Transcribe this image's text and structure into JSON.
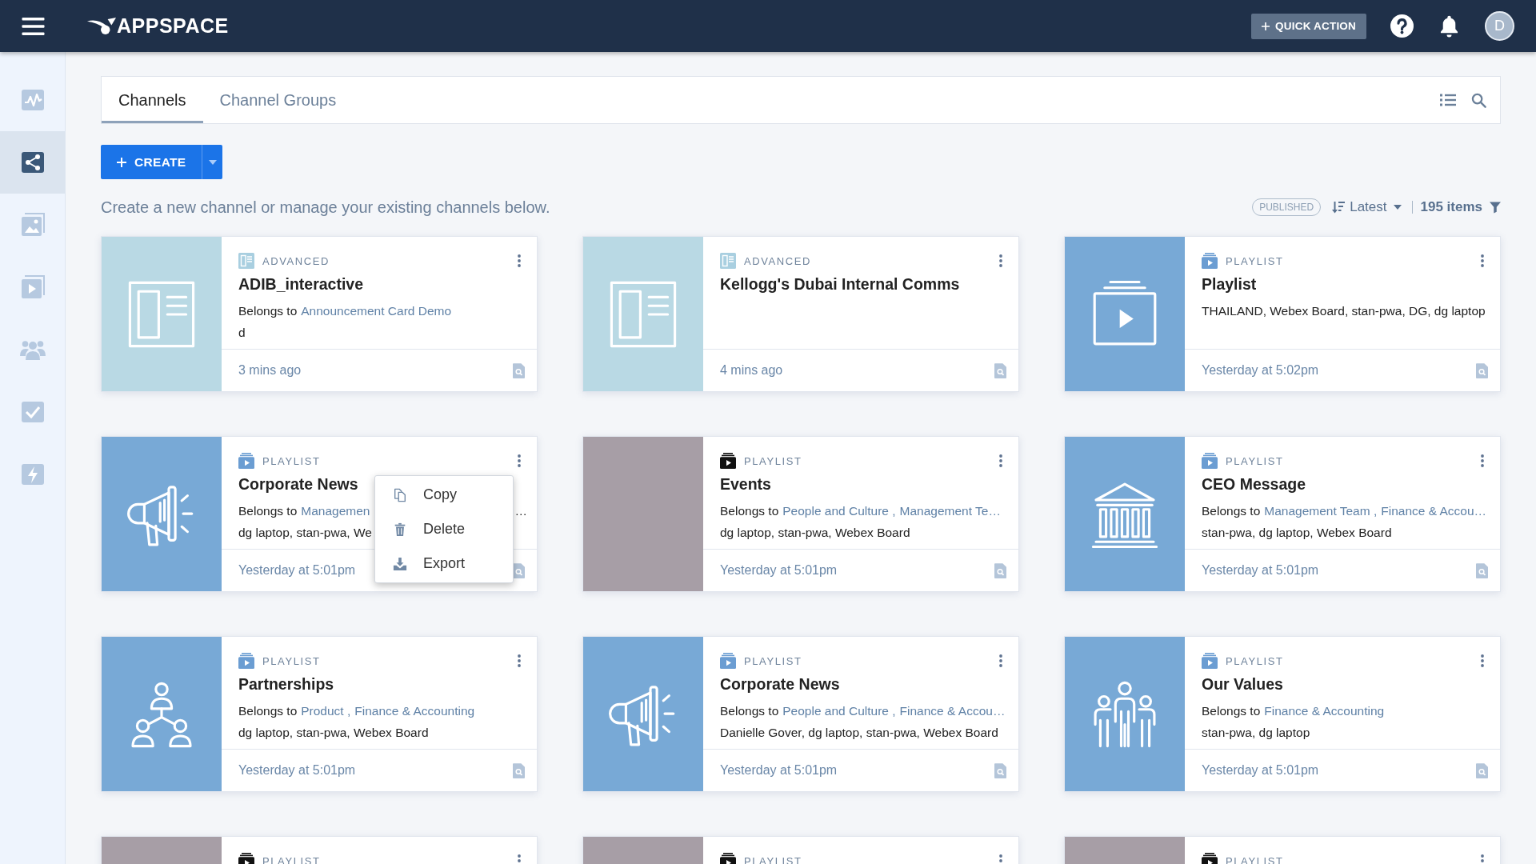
{
  "topbar": {
    "logo": "APPSPACE",
    "quick_action": "QUICK ACTION",
    "avatar": "D"
  },
  "sidebar": {
    "items": [
      {
        "kind": "chart",
        "selected": false
      },
      {
        "kind": "share",
        "selected": true
      },
      {
        "kind": "image",
        "selected": false
      },
      {
        "kind": "play",
        "selected": false
      },
      {
        "kind": "users",
        "selected": false
      },
      {
        "kind": "check",
        "selected": false
      },
      {
        "kind": "bolt",
        "selected": false
      }
    ]
  },
  "tabs": [
    {
      "label": "Channels",
      "selected": true
    },
    {
      "label": "Channel Groups",
      "selected": false
    }
  ],
  "create_button": {
    "label": "CREATE"
  },
  "description": "Create a new channel or manage your existing channels below.",
  "filters": {
    "status": "PUBLISHED",
    "sort": "Latest",
    "count": "195 items"
  },
  "cards": [
    {
      "type": {
        "kind": "advanced",
        "label": "ADVANCED"
      },
      "thumbnail": {
        "kind": "layout"
      },
      "title": "ADIB_interactive",
      "belongs": {
        "label": "Belongs to",
        "groups": [
          "Announcement Card Demo"
        ]
      },
      "devices": "d",
      "time": "3 mins ago"
    },
    {
      "type": {
        "kind": "advanced",
        "label": "ADVANCED"
      },
      "thumbnail": {
        "kind": "layout"
      },
      "title": "Kellogg's Dubai Internal Comms",
      "time": "4 mins ago"
    },
    {
      "type": {
        "kind": "playlist",
        "label": "PLAYLIST"
      },
      "thumbnail": {
        "kind": "play"
      },
      "title": "Playlist",
      "devices": "THAILAND, Webex Board, stan-pwa, DG, dg laptop",
      "time": "Yesterday at 5:02pm"
    },
    {
      "type": {
        "kind": "playlist",
        "label": "PLAYLIST"
      },
      "thumbnail": {
        "kind": "megaphone"
      },
      "title": "Corporate News",
      "belongs": {
        "label": "Belongs to",
        "groups": [
          "Managemen"
        ],
        "tail": "…"
      },
      "devices": "dg laptop, stan-pwa, We",
      "time": "Yesterday at 5:01pm",
      "menu": [
        {
          "kind": "copy",
          "label": "Copy"
        },
        {
          "kind": "delete",
          "label": "Delete"
        },
        {
          "kind": "export",
          "label": "Export"
        }
      ]
    },
    {
      "type": {
        "kind": "playlist",
        "label": "PLAYLIST"
      },
      "thumbnail": {
        "kind": "photo"
      },
      "title": "Events",
      "belongs": {
        "label": "Belongs to",
        "groups": [
          "People and Culture ,",
          "Management Te…"
        ]
      },
      "devices": "dg laptop, stan-pwa, Webex Board",
      "time": "Yesterday at 5:01pm"
    },
    {
      "type": {
        "kind": "playlist",
        "label": "PLAYLIST"
      },
      "thumbnail": {
        "kind": "bank"
      },
      "title": "CEO Message",
      "belongs": {
        "label": "Belongs to",
        "groups": [
          "Management Team ,",
          "Finance & Accou…"
        ]
      },
      "devices": "stan-pwa, dg laptop, Webex Board",
      "time": "Yesterday at 5:01pm"
    },
    {
      "type": {
        "kind": "playlist",
        "label": "PLAYLIST"
      },
      "thumbnail": {
        "kind": "network"
      },
      "title": "Partnerships",
      "belongs": {
        "label": "Belongs to",
        "groups": [
          "Product ,",
          "Finance & Accounting"
        ]
      },
      "devices": "dg laptop, stan-pwa, Webex Board",
      "time": "Yesterday at 5:01pm"
    },
    {
      "type": {
        "kind": "playlist",
        "label": "PLAYLIST"
      },
      "thumbnail": {
        "kind": "megaphone"
      },
      "title": "Corporate News",
      "belongs": {
        "label": "Belongs to",
        "groups": [
          "People and Culture ,",
          "Finance & Accou…"
        ]
      },
      "devices": "Danielle Gover, dg laptop, stan-pwa, Webex Board",
      "time": "Yesterday at 5:01pm"
    },
    {
      "type": {
        "kind": "playlist",
        "label": "PLAYLIST"
      },
      "thumbnail": {
        "kind": "team"
      },
      "title": "Our Values",
      "belongs": {
        "label": "Belongs to",
        "groups": [
          "Finance & Accounting"
        ]
      },
      "devices": "stan-pwa, dg laptop",
      "time": "Yesterday at 5:01pm"
    },
    {
      "type": {
        "kind": "playlist",
        "label": "PLAYLIST"
      },
      "thumbnail": {
        "kind": "photo"
      }
    },
    {
      "type": {
        "kind": "playlist",
        "label": "PLAYLIST"
      },
      "thumbnail": {
        "kind": "photo"
      }
    },
    {
      "type": {
        "kind": "playlist",
        "label": "PLAYLIST"
      },
      "thumbnail": {
        "kind": "photo"
      }
    }
  ]
}
